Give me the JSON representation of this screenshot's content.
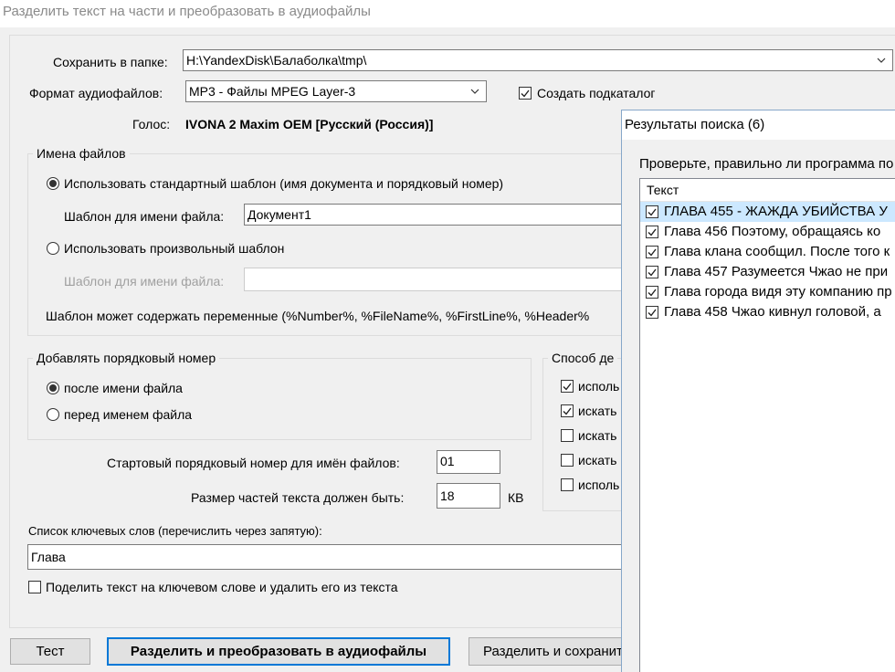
{
  "window": {
    "title": "Разделить текст на части и преобразовать в аудиофайлы"
  },
  "save_folder": {
    "label": "Сохранить в папке:",
    "value": "H:\\YandexDisk\\Балаболка\\tmp\\"
  },
  "audio_format": {
    "label": "Формат аудиофайлов:",
    "value": "MP3 - Файлы MPEG Layer-3"
  },
  "create_subfolder": {
    "label": "Создать подкаталог",
    "checked": true
  },
  "voice": {
    "label": "Голос:",
    "value": "IVONA 2 Maxim OEM [Русский (Россия)]"
  },
  "filenames": {
    "title": "Имена файлов",
    "standard_option": "Использовать стандартный шаблон (имя документа и порядковый номер)",
    "template_label": "Шаблон для имени файла:",
    "template_value": "Документ1",
    "custom_option": "Использовать произвольный шаблон",
    "custom_template_label": "Шаблон для имени файла:",
    "custom_template_value": "",
    "hint": "Шаблон может содержать переменные (%Number%, %FileName%, %FirstLine%, %Header%"
  },
  "numbering": {
    "title": "Добавлять порядковый номер",
    "after": "после имени файла",
    "before": "перед именем файла"
  },
  "split_method": {
    "title": "Способ де",
    "items": [
      {
        "label": "исполь",
        "checked": true
      },
      {
        "label": "искать",
        "checked": true
      },
      {
        "label": "искать",
        "checked": false
      },
      {
        "label": "искать",
        "checked": false
      },
      {
        "label": "исполь",
        "checked": false
      }
    ]
  },
  "start_number": {
    "label": "Стартовый порядковый номер для имён файлов:",
    "value": "01"
  },
  "part_size": {
    "label": "Размер частей текста должен быть:",
    "value": "18",
    "unit": "КВ"
  },
  "keywords": {
    "label": "Список ключевых слов (перечислить через запятую):",
    "value": "Глава"
  },
  "split_on_keyword": {
    "label": "Поделить текст на ключевом слове и удалить его из текста",
    "checked": false
  },
  "buttons": {
    "test": "Тест",
    "split_convert": "Разделить и преобразовать в аудиофайлы",
    "split_save": "Разделить и сохранит"
  },
  "results": {
    "title": "Результаты поиска (6)",
    "description": "Проверьте, правильно ли программа по",
    "column": "Текст",
    "rows": [
      {
        "text": "ГЛАВА 455 - ЖАЖДА УБИЙСТВА   У",
        "checked": true,
        "selected": true
      },
      {
        "text": "Глава 456   Поэтому, обращаясь ко",
        "checked": true,
        "selected": false
      },
      {
        "text": "Глава клана сообщил.  После того к",
        "checked": true,
        "selected": false
      },
      {
        "text": "Глава 457   Разумеется Чжао не при",
        "checked": true,
        "selected": false
      },
      {
        "text": "Глава города видя эту компанию пр",
        "checked": true,
        "selected": false
      },
      {
        "text": "Глава 458   Чжао кивнул головой, а",
        "checked": true,
        "selected": false
      }
    ]
  }
}
